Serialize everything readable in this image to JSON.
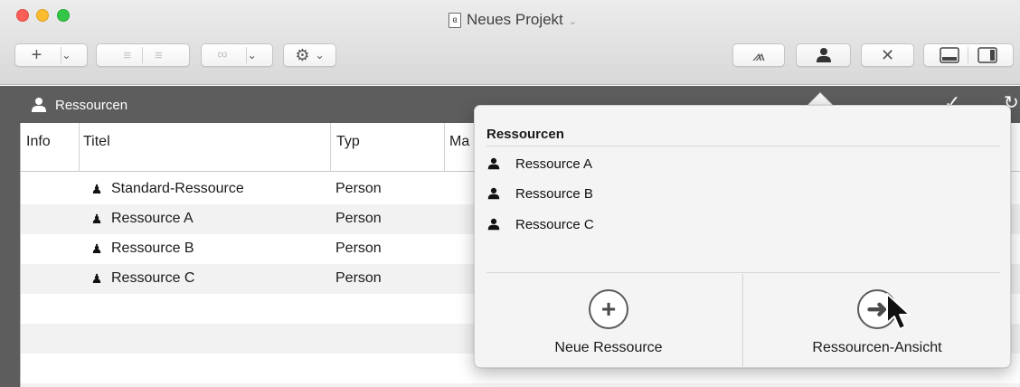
{
  "window": {
    "title": "Neues Projekt",
    "doc_icon": "ɞ"
  },
  "toolbar": {
    "add_label": "+",
    "chevron": "⌄",
    "indent_icon": "indent-icon",
    "outdent_icon": "outdent-icon",
    "link_icon": "link-icon",
    "gear_icon": "gear-icon",
    "inspector_icons": [
      "lightning-icon",
      "person-icon",
      "tools-icon",
      "bottom-pane-icon",
      "side-pane-icon"
    ]
  },
  "pane": {
    "title": "Ressourcen"
  },
  "table": {
    "columns": [
      "Info",
      "Titel",
      "Typ",
      "Ma"
    ],
    "rows": [
      {
        "title": "Standard-Ressource",
        "type": "Person"
      },
      {
        "title": "Ressource A",
        "type": "Person"
      },
      {
        "title": "Ressource B",
        "type": "Person"
      },
      {
        "title": "Ressource C",
        "type": "Person"
      }
    ]
  },
  "popover": {
    "title": "Ressourcen",
    "items": [
      "Ressource A",
      "Ressource B",
      "Ressource C"
    ],
    "new_button_label": "Neue Ressource",
    "view_button_label": "Ressourcen-Ansicht"
  },
  "colors": {
    "header_band": "#5d5d5d",
    "alt_row": "#f2f2f2",
    "popover_bg": "#f4f4f4"
  }
}
